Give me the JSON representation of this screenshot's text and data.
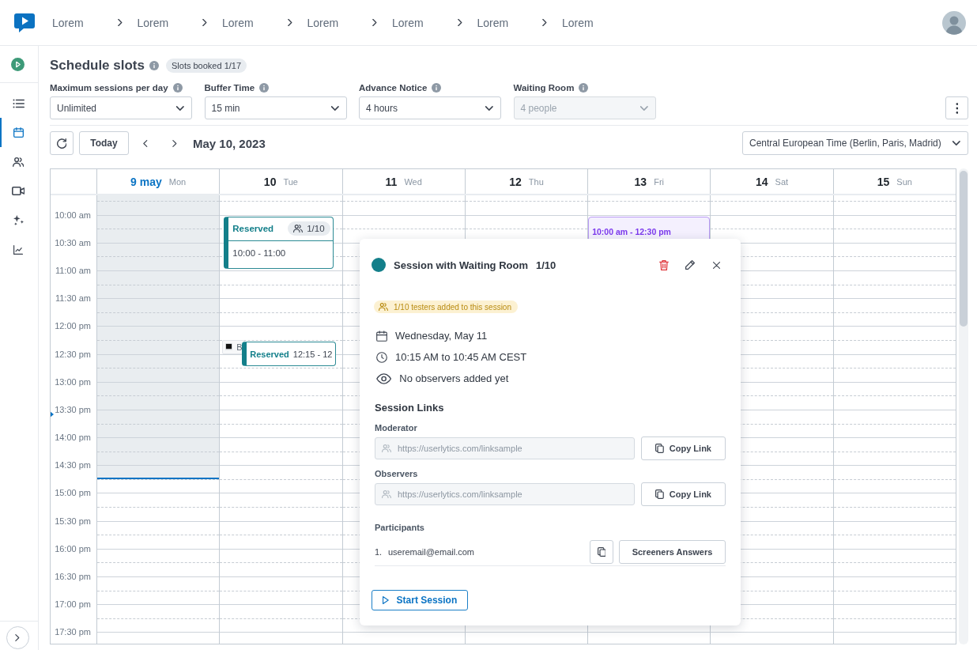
{
  "topbar": {
    "breadcrumbs": [
      "Lorem",
      "Lorem",
      "Lorem",
      "Lorem",
      "Lorem",
      "Lorem",
      "Lorem"
    ]
  },
  "sidebar": {
    "nav": [
      {
        "selected": false
      },
      {
        "selected": true
      },
      {
        "selected": false
      },
      {
        "selected": false
      },
      {
        "selected": false
      },
      {
        "selected": false
      }
    ]
  },
  "header": {
    "title": "Schedule slots",
    "badge": "Slots booked 1/17"
  },
  "settings": [
    {
      "label": "Maximum sessions per day",
      "value": "Unlimited",
      "disabled": false
    },
    {
      "label": "Buffer Time",
      "value": "15 min",
      "disabled": false
    },
    {
      "label": "Advance Notice",
      "value": "4 hours",
      "disabled": false
    },
    {
      "label": "Waiting Room",
      "value": "4 people",
      "disabled": true
    }
  ],
  "toolbar": {
    "today": "Today",
    "date": "May 10, 2023",
    "timezone": "Central European Time (Berlin, Paris, Madrid)"
  },
  "calendar": {
    "times": [
      "10:00 am",
      "10:30 am",
      "11:00 am",
      "11:30 am",
      "12:00 pm",
      "12:30 pm",
      "13:00 pm",
      "13:30 pm",
      "14:00 pm",
      "14:30 pm",
      "15:00 pm",
      "15:30 pm",
      "16:00 pm",
      "16:30 pm",
      "17:00 pm",
      "17:30 pm"
    ],
    "days": [
      {
        "date": "9 may",
        "weekday": "Mon",
        "today": true
      },
      {
        "date": "10",
        "weekday": "Tue",
        "today": false,
        "events": [
          {
            "kind": "reserved",
            "title": "Reserved",
            "count": "1/10",
            "time": "10:00 - 11:00"
          },
          {
            "kind": "busy",
            "title": "B"
          },
          {
            "kind": "reserved",
            "title": "Reserved",
            "time": "12:15 - 12"
          }
        ]
      },
      {
        "date": "11",
        "weekday": "Wed",
        "today": false
      },
      {
        "date": "12",
        "weekday": "Thu",
        "today": false
      },
      {
        "date": "13",
        "weekday": "Fri",
        "today": false,
        "events": [
          {
            "kind": "slot",
            "time": "10:00 am - 12:30 pm"
          }
        ]
      },
      {
        "date": "14",
        "weekday": "Sat",
        "today": false
      },
      {
        "date": "15",
        "weekday": "Sun",
        "today": false
      }
    ]
  },
  "session_popup": {
    "title": "Session with Waiting Room",
    "count": "1/10",
    "notice": "1/10 testers added to this session",
    "details": [
      "Wednesday, May 11",
      "10:15 AM to 10:45 AM CEST",
      "No observers added yet"
    ],
    "links_heading": "Session Links",
    "links": [
      {
        "label": "Moderator",
        "value": "https://userlytics.com/linksample",
        "disabled": true,
        "button": "Copy Link"
      },
      {
        "label": "Observers",
        "value": "https://userlytics.com/linksample",
        "disabled": true,
        "button": "Copy Link"
      }
    ],
    "participants_heading": "Participants",
    "participants": [
      {
        "number": "1.",
        "email": "useremail@email.com",
        "button": "Screeners Answers"
      }
    ],
    "start_button": "Start Session"
  }
}
